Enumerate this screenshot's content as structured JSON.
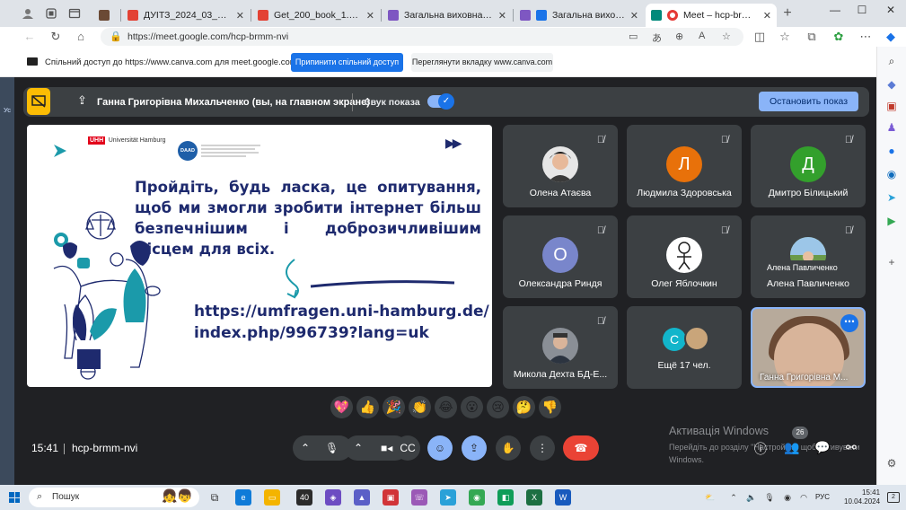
{
  "browser": {
    "tabs": [
      {
        "label": "",
        "color": "#6b4a35"
      },
      {
        "label": "ДУІТЗ_2024_03_22_Інформ_л",
        "color": "#e34234"
      },
      {
        "label": "Get_200_book_1.pdf",
        "color": "#e34234"
      },
      {
        "label": "Загальна виховна година на",
        "color": "#7e57c2"
      },
      {
        "label": "Загальна виховна годин",
        "color": "#7e57c2"
      },
      {
        "label": "Meet – hcp-brmm-nvi",
        "color": "#00897b"
      }
    ],
    "url": "https://meet.google.com/hcp-brmm-nvi"
  },
  "share_bar": {
    "text": "Спільний доступ до https://www.canva.com для meet.google.com",
    "stop_label": "Припинити спільний доступ",
    "switch_label": "Переглянути вкладку www.canva.com"
  },
  "left_sliver": {
    "text1": "Вс",
    "text2": "Ус"
  },
  "meet": {
    "presenting": {
      "name": "Ганна Григорівна Михальченко (вы, на главном экране)",
      "sound_label": "Звук показа",
      "stop_label": "Остановить показ"
    },
    "slide": {
      "heading": "Пройдіть, будь ласка, це опитування, щоб ми змогли зробити інтернет більш безпечнішим і доброзичливішим місцем для всіх.",
      "link": "https://umfragen.uni-hamburg.de/index.php/996739?lang=uk",
      "uhh_mark": "UHH",
      "uhh_name": "Universität Hamburg",
      "daad": "DAAD"
    },
    "participants": [
      {
        "name": "Олена Атаєва",
        "initial": "",
        "color": "#5f6368"
      },
      {
        "name": "Людмила Здоровська",
        "initial": "Л",
        "color": "#e8710a"
      },
      {
        "name": "Дмитро Білицький",
        "initial": "Д",
        "color": "#33a02c"
      },
      {
        "name": "Олександра Риндя",
        "initial": "О",
        "color": "#7986cb"
      },
      {
        "name": "Олег Яблочкин",
        "initial": "",
        "color": "#ffffff"
      },
      {
        "name": "Алена Павличенко",
        "initial": "",
        "color": "#7fae6a"
      },
      {
        "name": "Микола Дехта БД-Е...",
        "initial": "",
        "color": "#8a8f96"
      }
    ],
    "more_tile": {
      "initial": "С",
      "label": "Ещё 17 чел."
    },
    "self_tile": {
      "name": "Ганна Григорівна М..."
    },
    "tooltip": "Алена Павличенко",
    "reactions": [
      "💖",
      "👍",
      "🎉",
      "👏",
      "😂",
      "😮",
      "😢",
      "🤔",
      "👎"
    ],
    "clock": "15:41",
    "meet_code": "hcp-brmm-nvi",
    "activation_title": "Активація Windows",
    "activation_sub": "Перейдіть до розділу \"Настройки\", щоб активувати Windows.",
    "participants_count": "26"
  },
  "taskbar": {
    "search_placeholder": "Пошук",
    "lang": "РУС",
    "time": "15:41",
    "date": "10.04.2024",
    "notif_count": "2"
  }
}
